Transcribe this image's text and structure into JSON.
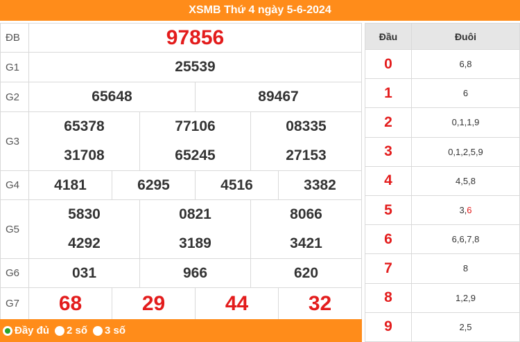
{
  "header": {
    "title": "XSMB Thứ 4 ngày 5-6-2024"
  },
  "prizes": {
    "db": {
      "label": "ĐB",
      "values": [
        "97856"
      ]
    },
    "g1": {
      "label": "G1",
      "values": [
        "25539"
      ]
    },
    "g2": {
      "label": "G2",
      "values": [
        "65648",
        "89467"
      ]
    },
    "g3": {
      "label": "G3",
      "values": [
        "65378",
        "77106",
        "08335",
        "31708",
        "65245",
        "27153"
      ]
    },
    "g4": {
      "label": "G4",
      "values": [
        "4181",
        "6295",
        "4516",
        "3382"
      ]
    },
    "g5": {
      "label": "G5",
      "values": [
        "5830",
        "0821",
        "8066",
        "4292",
        "3189",
        "3421"
      ]
    },
    "g6": {
      "label": "G6",
      "values": [
        "031",
        "966",
        "620"
      ]
    },
    "g7": {
      "label": "G7",
      "values": [
        "68",
        "29",
        "44",
        "32"
      ]
    }
  },
  "footer": {
    "options": [
      {
        "label": "Đầy đủ",
        "selected": true
      },
      {
        "label": "2 số",
        "selected": false
      },
      {
        "label": "3 số",
        "selected": false
      }
    ]
  },
  "loto": {
    "head_label": "Đầu",
    "tail_label": "Đuôi",
    "rows": [
      {
        "head": "0",
        "tails": "6,8"
      },
      {
        "head": "1",
        "tails": "6"
      },
      {
        "head": "2",
        "tails": "0,1,1,9"
      },
      {
        "head": "3",
        "tails": "0,1,2,5,9"
      },
      {
        "head": "4",
        "tails": "4,5,8"
      },
      {
        "head": "5",
        "tails_pre": "3,",
        "tails_hl": "6"
      },
      {
        "head": "6",
        "tails": "6,6,7,8"
      },
      {
        "head": "7",
        "tails": "8"
      },
      {
        "head": "8",
        "tails": "1,2,9"
      },
      {
        "head": "9",
        "tails": "2,5"
      }
    ]
  },
  "colors": {
    "accent": "#ff8c1a",
    "highlight": "#e31c1c",
    "selected_radio": "#2aa52a"
  }
}
